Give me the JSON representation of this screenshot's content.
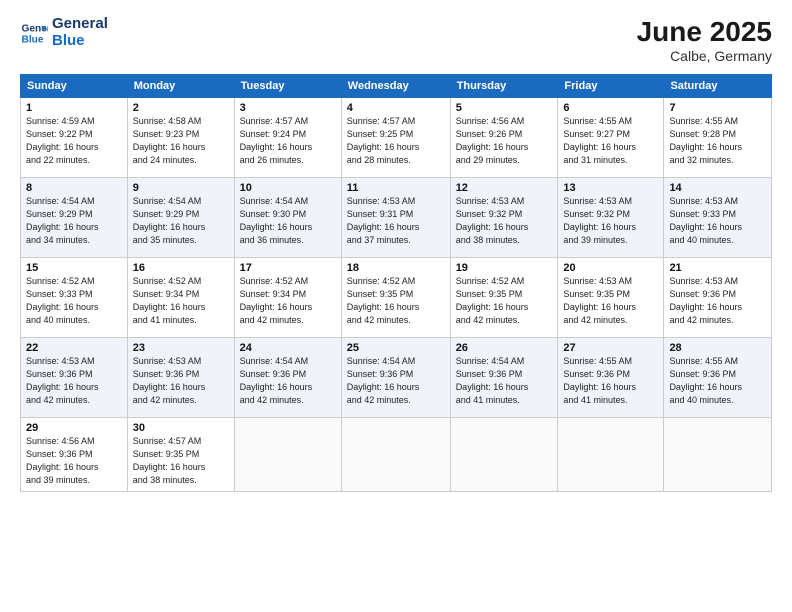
{
  "header": {
    "logo_line1": "General",
    "logo_line2": "Blue",
    "month_year": "June 2025",
    "location": "Calbe, Germany"
  },
  "weekdays": [
    "Sunday",
    "Monday",
    "Tuesday",
    "Wednesday",
    "Thursday",
    "Friday",
    "Saturday"
  ],
  "weeks": [
    [
      {
        "day": "1",
        "info": "Sunrise: 4:59 AM\nSunset: 9:22 PM\nDaylight: 16 hours\nand 22 minutes."
      },
      {
        "day": "2",
        "info": "Sunrise: 4:58 AM\nSunset: 9:23 PM\nDaylight: 16 hours\nand 24 minutes."
      },
      {
        "day": "3",
        "info": "Sunrise: 4:57 AM\nSunset: 9:24 PM\nDaylight: 16 hours\nand 26 minutes."
      },
      {
        "day": "4",
        "info": "Sunrise: 4:57 AM\nSunset: 9:25 PM\nDaylight: 16 hours\nand 28 minutes."
      },
      {
        "day": "5",
        "info": "Sunrise: 4:56 AM\nSunset: 9:26 PM\nDaylight: 16 hours\nand 29 minutes."
      },
      {
        "day": "6",
        "info": "Sunrise: 4:55 AM\nSunset: 9:27 PM\nDaylight: 16 hours\nand 31 minutes."
      },
      {
        "day": "7",
        "info": "Sunrise: 4:55 AM\nSunset: 9:28 PM\nDaylight: 16 hours\nand 32 minutes."
      }
    ],
    [
      {
        "day": "8",
        "info": "Sunrise: 4:54 AM\nSunset: 9:29 PM\nDaylight: 16 hours\nand 34 minutes."
      },
      {
        "day": "9",
        "info": "Sunrise: 4:54 AM\nSunset: 9:29 PM\nDaylight: 16 hours\nand 35 minutes."
      },
      {
        "day": "10",
        "info": "Sunrise: 4:54 AM\nSunset: 9:30 PM\nDaylight: 16 hours\nand 36 minutes."
      },
      {
        "day": "11",
        "info": "Sunrise: 4:53 AM\nSunset: 9:31 PM\nDaylight: 16 hours\nand 37 minutes."
      },
      {
        "day": "12",
        "info": "Sunrise: 4:53 AM\nSunset: 9:32 PM\nDaylight: 16 hours\nand 38 minutes."
      },
      {
        "day": "13",
        "info": "Sunrise: 4:53 AM\nSunset: 9:32 PM\nDaylight: 16 hours\nand 39 minutes."
      },
      {
        "day": "14",
        "info": "Sunrise: 4:53 AM\nSunset: 9:33 PM\nDaylight: 16 hours\nand 40 minutes."
      }
    ],
    [
      {
        "day": "15",
        "info": "Sunrise: 4:52 AM\nSunset: 9:33 PM\nDaylight: 16 hours\nand 40 minutes."
      },
      {
        "day": "16",
        "info": "Sunrise: 4:52 AM\nSunset: 9:34 PM\nDaylight: 16 hours\nand 41 minutes."
      },
      {
        "day": "17",
        "info": "Sunrise: 4:52 AM\nSunset: 9:34 PM\nDaylight: 16 hours\nand 42 minutes."
      },
      {
        "day": "18",
        "info": "Sunrise: 4:52 AM\nSunset: 9:35 PM\nDaylight: 16 hours\nand 42 minutes."
      },
      {
        "day": "19",
        "info": "Sunrise: 4:52 AM\nSunset: 9:35 PM\nDaylight: 16 hours\nand 42 minutes."
      },
      {
        "day": "20",
        "info": "Sunrise: 4:53 AM\nSunset: 9:35 PM\nDaylight: 16 hours\nand 42 minutes."
      },
      {
        "day": "21",
        "info": "Sunrise: 4:53 AM\nSunset: 9:36 PM\nDaylight: 16 hours\nand 42 minutes."
      }
    ],
    [
      {
        "day": "22",
        "info": "Sunrise: 4:53 AM\nSunset: 9:36 PM\nDaylight: 16 hours\nand 42 minutes."
      },
      {
        "day": "23",
        "info": "Sunrise: 4:53 AM\nSunset: 9:36 PM\nDaylight: 16 hours\nand 42 minutes."
      },
      {
        "day": "24",
        "info": "Sunrise: 4:54 AM\nSunset: 9:36 PM\nDaylight: 16 hours\nand 42 minutes."
      },
      {
        "day": "25",
        "info": "Sunrise: 4:54 AM\nSunset: 9:36 PM\nDaylight: 16 hours\nand 42 minutes."
      },
      {
        "day": "26",
        "info": "Sunrise: 4:54 AM\nSunset: 9:36 PM\nDaylight: 16 hours\nand 41 minutes."
      },
      {
        "day": "27",
        "info": "Sunrise: 4:55 AM\nSunset: 9:36 PM\nDaylight: 16 hours\nand 41 minutes."
      },
      {
        "day": "28",
        "info": "Sunrise: 4:55 AM\nSunset: 9:36 PM\nDaylight: 16 hours\nand 40 minutes."
      }
    ],
    [
      {
        "day": "29",
        "info": "Sunrise: 4:56 AM\nSunset: 9:36 PM\nDaylight: 16 hours\nand 39 minutes."
      },
      {
        "day": "30",
        "info": "Sunrise: 4:57 AM\nSunset: 9:35 PM\nDaylight: 16 hours\nand 38 minutes."
      },
      {
        "day": "",
        "info": ""
      },
      {
        "day": "",
        "info": ""
      },
      {
        "day": "",
        "info": ""
      },
      {
        "day": "",
        "info": ""
      },
      {
        "day": "",
        "info": ""
      }
    ]
  ]
}
